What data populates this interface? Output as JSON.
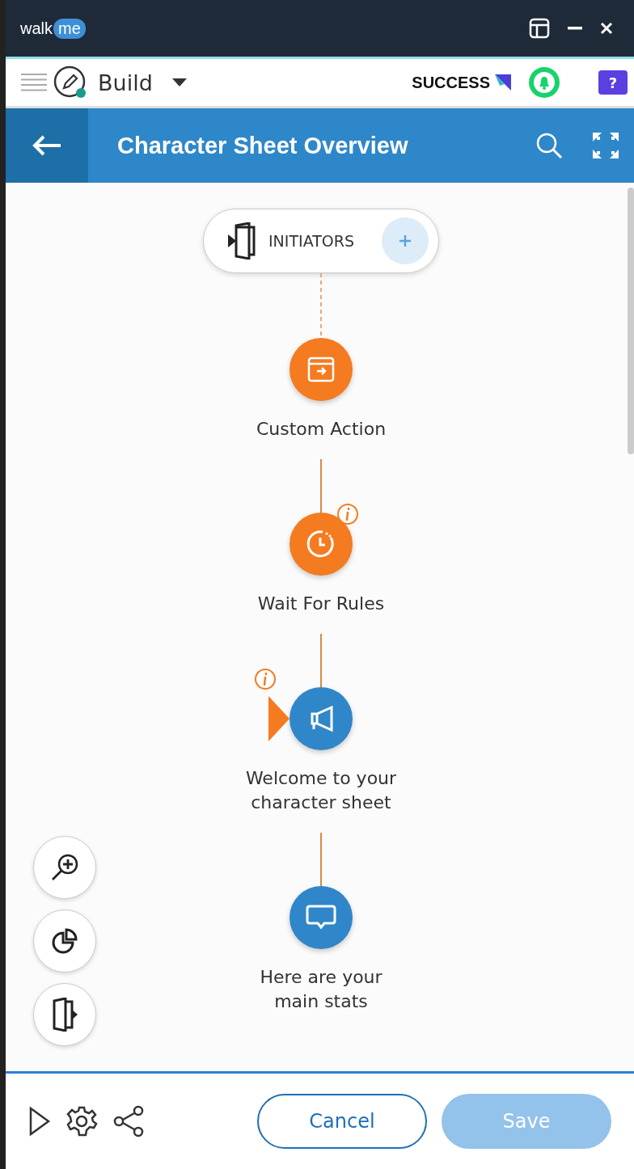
{
  "window": {
    "brand": [
      "walk",
      "me"
    ]
  },
  "toolbar": {
    "mode": "Build",
    "badge": "SUCCESS",
    "help": "?"
  },
  "header": {
    "title": "Character Sheet Overview"
  },
  "flow": {
    "initiators": {
      "label": "INITIATORS"
    },
    "steps": [
      {
        "kind": "custom_action",
        "title": "Custom Action",
        "color": "#f47b20",
        "info": false
      },
      {
        "kind": "wait",
        "title": "Wait For Rules",
        "color": "#f47b20",
        "info": true
      },
      {
        "kind": "announcement",
        "title": "Welcome to your character sheet",
        "color": "#2f86c9",
        "info": true
      },
      {
        "kind": "balloon",
        "title": "Here are your main stats",
        "color": "#2f86c9",
        "info": false
      }
    ]
  },
  "footer": {
    "buttons": [
      {
        "label": "Cancel",
        "disabled": false
      },
      {
        "label": "Save",
        "disabled": true
      }
    ]
  }
}
